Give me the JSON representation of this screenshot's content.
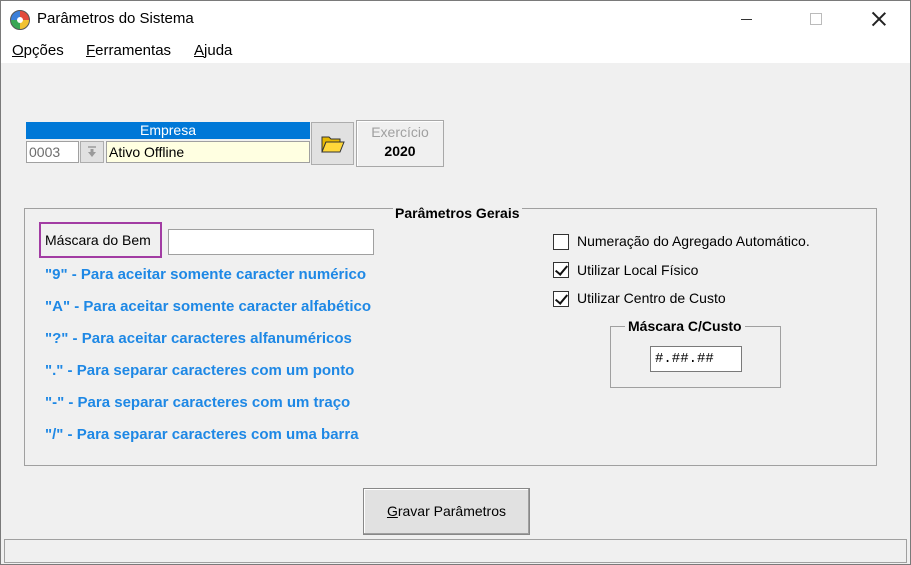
{
  "window": {
    "title": "Parâmetros do Sistema",
    "close_symbol": "✕"
  },
  "menu": [
    {
      "label_u": "O",
      "label_rest": "pções"
    },
    {
      "label_u": "F",
      "label_rest": "erramentas"
    },
    {
      "label_u": "A",
      "label_rest": "juda"
    }
  ],
  "empresa": {
    "header": "Empresa",
    "code": "0003",
    "name": "Ativo Offline",
    "dropdown_icon": "down-arrow-icon"
  },
  "exercicio": {
    "label": "Exercício",
    "year": "2020"
  },
  "parametros_gerais": {
    "title": "Parâmetros Gerais",
    "mascara_label": "Máscara do Bem",
    "mascara_value": "",
    "hints": [
      "\"9\" - Para aceitar somente caracter numérico",
      "\"A\" - Para aceitar somente caracter alfabético",
      "\"?\" - Para aceitar caracteres alfanuméricos",
      "\".\" - Para separar caracteres com um ponto",
      "\"-\" - Para separar caracteres com um traço",
      "\"/\" - Para separar caracteres com uma barra"
    ],
    "hint_color": "#1e88e5",
    "checkboxes": [
      {
        "label": "Numeração do Agregado Automático.",
        "checked": false
      },
      {
        "label": "Utilizar Local Físico",
        "checked": true
      },
      {
        "label": "Utilizar Centro de Custo",
        "checked": true
      }
    ],
    "mascara_custo": {
      "title": "Máscara C/Custo",
      "value": "#.##.##"
    }
  },
  "save_button": {
    "label_u": "G",
    "label_rest": "ravar Parâmetros"
  },
  "colors": {
    "accent": "#0078d7",
    "highlight_border": "#a23ca3",
    "input_yellow": "#ffffe1"
  }
}
